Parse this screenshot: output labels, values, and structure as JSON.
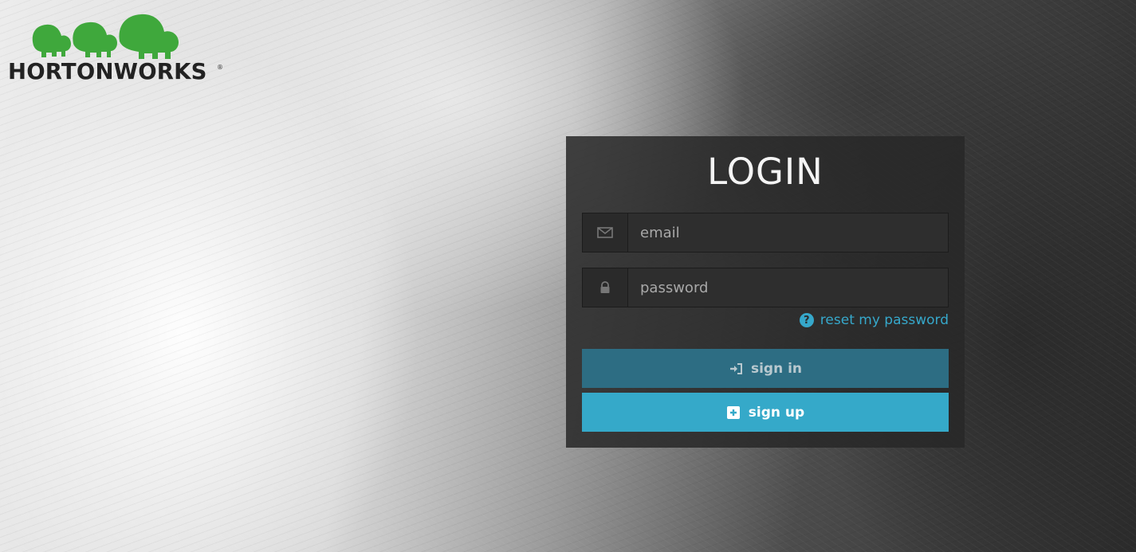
{
  "brand": {
    "name": "HORTONWORKS",
    "registered_mark": "®",
    "logo_color": "#3fa83c"
  },
  "login": {
    "title": "LOGIN",
    "email": {
      "placeholder": "email",
      "value": "",
      "icon": "envelope-icon"
    },
    "password": {
      "placeholder": "password",
      "value": "",
      "icon": "lock-icon"
    },
    "reset_password": {
      "label": "reset my password",
      "icon": "question-circle-icon"
    },
    "sign_in": {
      "label": "sign in",
      "icon": "sign-in-icon"
    },
    "sign_up": {
      "label": "sign up",
      "icon": "plus-square-icon"
    }
  },
  "colors": {
    "accent": "#36a8cb",
    "sign_in_button": "#2d6d83",
    "sign_up_button": "#35a9c9"
  }
}
